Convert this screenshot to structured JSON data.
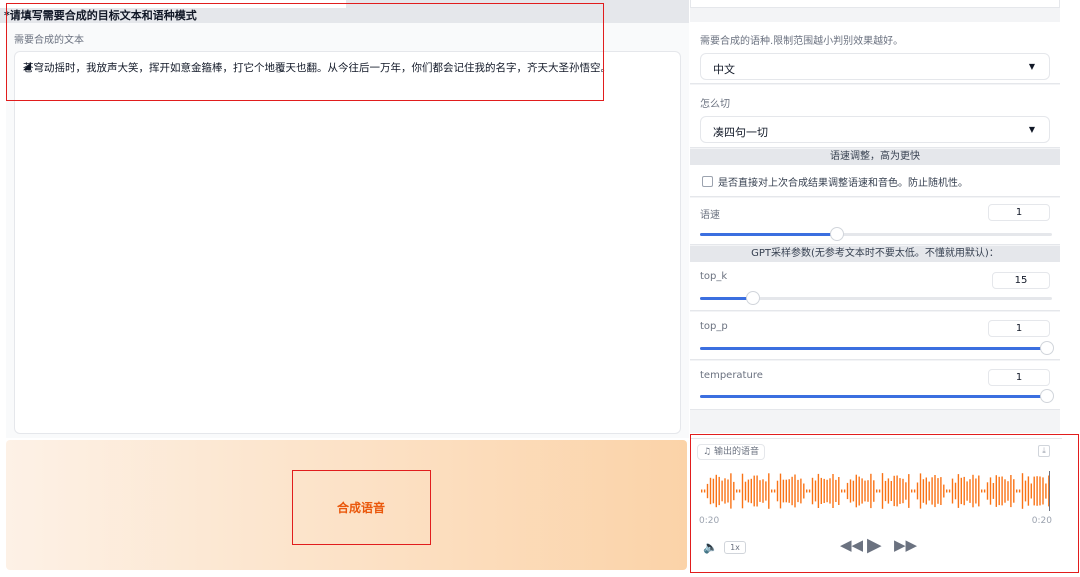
{
  "form": {
    "section_title": "*请填写需要合成的目标文本和语种模式",
    "text_label": "需要合成的文本",
    "text_value": "苍穹动摇时，我放声大笑，挥开如意金箍棒，打它个地覆天也翻。从今往后一万年，你们都会记住我的名字，齐天大圣孙悟空。",
    "synth_button": "合成语音"
  },
  "settings": {
    "language_label": "需要合成的语种.限制范围越小判别效果越好。",
    "language_value": "中文",
    "cut_label": "怎么切",
    "cut_value": "凑四句一切",
    "speed_header": "语速调整，高为更快",
    "reuse_checkbox_label": "是否直接对上次合成结果调整语速和音色。防止随机性。",
    "reuse_checked": false,
    "speed_label": "语速",
    "speed_value": "1",
    "gpt_header": "GPT采样参数(无参考文本时不要太低。不懂就用默认)：",
    "top_k_label": "top_k",
    "top_k_value": "15",
    "top_p_label": "top_p",
    "top_p_value": "1",
    "temperature_label": "temperature",
    "temperature_value": "1",
    "slider_levels": {
      "speed": 0.39,
      "top_k": 0.15,
      "top_p": 1.0,
      "temperature": 1.0
    }
  },
  "audio": {
    "tag_label": "输出的语音",
    "time_current": "0:20",
    "time_total": "0:20",
    "playback_rate": "1x"
  },
  "icons": {
    "dropdown": "chevron-down-icon",
    "music": "music-note-icon",
    "download": "download-icon",
    "volume": "volume-icon",
    "rewind": "rewind-icon",
    "play": "play-icon",
    "forward": "fast-forward-icon"
  },
  "colors": {
    "accent": "#ea580c",
    "slider": "#3b6fe0",
    "waveform": "#f97316",
    "highlight_box": "#e11d1d"
  }
}
